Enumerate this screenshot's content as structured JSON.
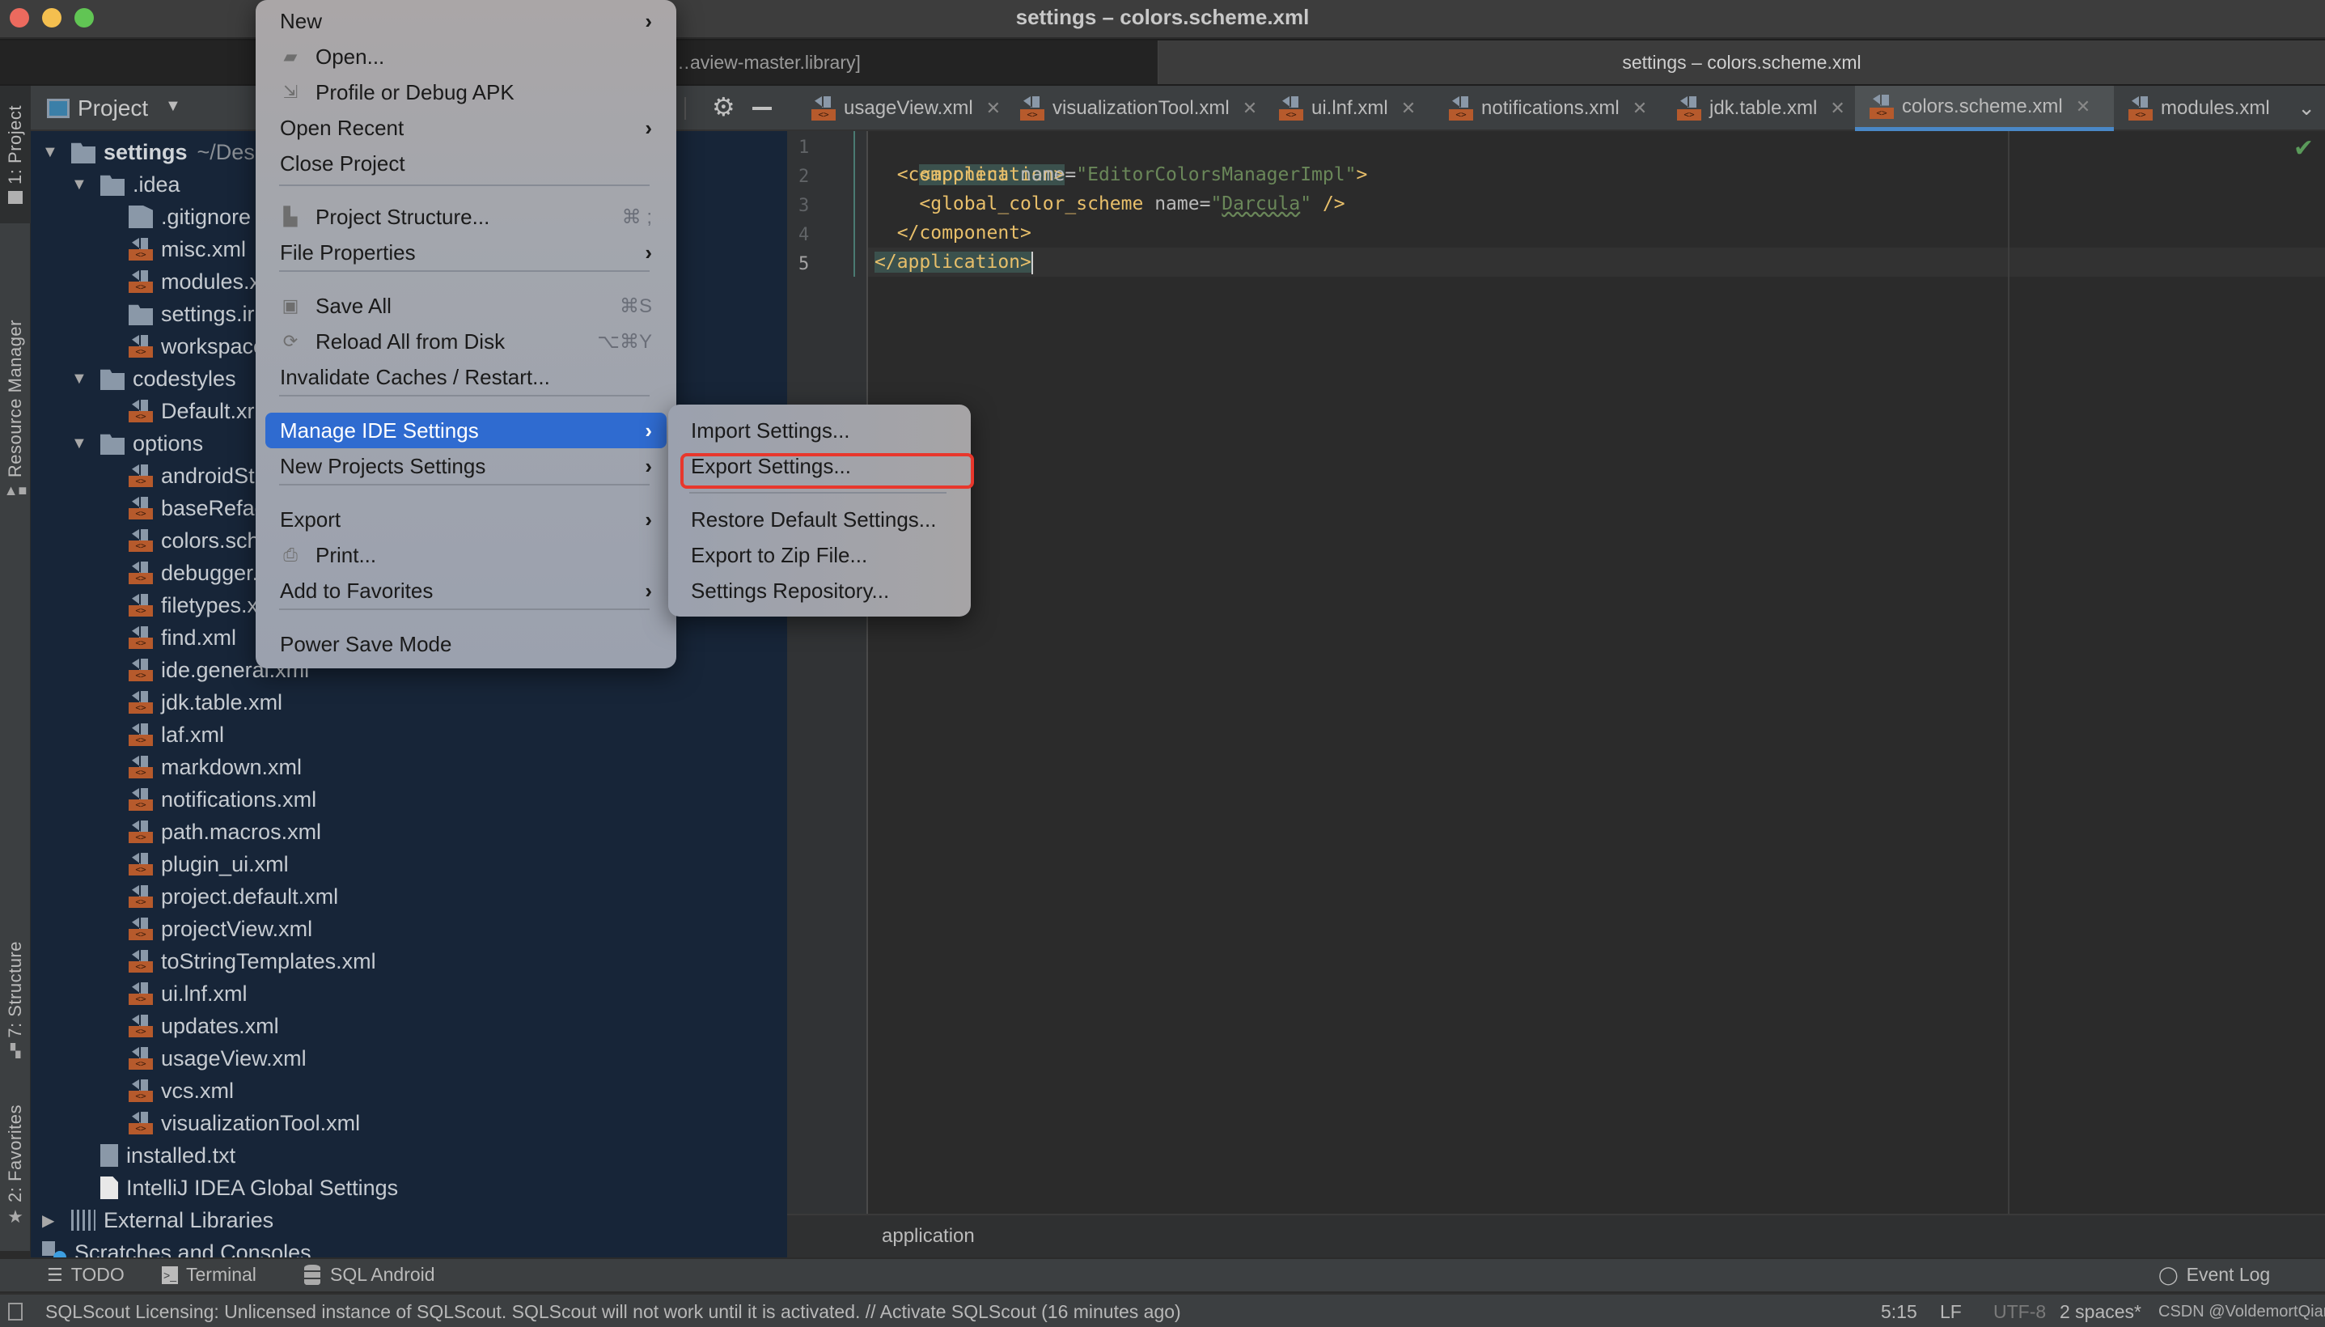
{
  "window": {
    "title": "settings – colors.scheme.xml",
    "tabs": [
      {
        "label": "…aview-master.library]",
        "active": false
      },
      {
        "label": "settings – colors.scheme.xml",
        "active": true
      }
    ]
  },
  "tool_stripe": {
    "left": [
      {
        "label": "1: Project",
        "active": true
      },
      {
        "label": "Resource Manager",
        "active": false
      },
      {
        "label": "7: Structure",
        "active": false
      },
      {
        "label": "2: Favorites",
        "active": false
      }
    ]
  },
  "project_panel": {
    "title": "Project",
    "tree": [
      {
        "label": "settings",
        "suffix": "~/Des",
        "type": "module",
        "depth": 0,
        "expanded": true
      },
      {
        "label": ".idea",
        "type": "folder",
        "depth": 1,
        "expanded": true
      },
      {
        "label": ".gitignore",
        "type": "ignore",
        "depth": 2
      },
      {
        "label": "misc.xml",
        "type": "xml",
        "depth": 2
      },
      {
        "label": "modules.x",
        "type": "xml",
        "depth": 2
      },
      {
        "label": "settings.ir",
        "type": "module",
        "depth": 2
      },
      {
        "label": "workspace",
        "type": "xml",
        "depth": 2
      },
      {
        "label": "codestyles",
        "type": "folder",
        "depth": 1,
        "expanded": true
      },
      {
        "label": "Default.xr",
        "type": "xml",
        "depth": 2
      },
      {
        "label": "options",
        "type": "folder",
        "depth": 1,
        "expanded": true
      },
      {
        "label": "androidSt",
        "type": "xml",
        "depth": 2
      },
      {
        "label": "baseRefac",
        "type": "xml",
        "depth": 2
      },
      {
        "label": "colors.sch",
        "type": "xml",
        "depth": 2
      },
      {
        "label": "debugger.",
        "type": "xml",
        "depth": 2
      },
      {
        "label": "filetypes.x",
        "type": "xml",
        "depth": 2
      },
      {
        "label": "find.xml",
        "type": "xml",
        "depth": 2
      },
      {
        "label": "ide.general.xml",
        "type": "xml",
        "depth": 2
      },
      {
        "label": "jdk.table.xml",
        "type": "xml",
        "depth": 2
      },
      {
        "label": "laf.xml",
        "type": "xml",
        "depth": 2
      },
      {
        "label": "markdown.xml",
        "type": "xml",
        "depth": 2
      },
      {
        "label": "notifications.xml",
        "type": "xml",
        "depth": 2
      },
      {
        "label": "path.macros.xml",
        "type": "xml",
        "depth": 2
      },
      {
        "label": "plugin_ui.xml",
        "type": "xml",
        "depth": 2
      },
      {
        "label": "project.default.xml",
        "type": "xml",
        "depth": 2
      },
      {
        "label": "projectView.xml",
        "type": "xml",
        "depth": 2
      },
      {
        "label": "toStringTemplates.xml",
        "type": "xml",
        "depth": 2
      },
      {
        "label": "ui.lnf.xml",
        "type": "xml",
        "depth": 2
      },
      {
        "label": "updates.xml",
        "type": "xml",
        "depth": 2
      },
      {
        "label": "usageView.xml",
        "type": "xml",
        "depth": 2
      },
      {
        "label": "vcs.xml",
        "type": "xml",
        "depth": 2
      },
      {
        "label": "visualizationTool.xml",
        "type": "xml",
        "depth": 2
      },
      {
        "label": "installed.txt",
        "type": "txt",
        "depth": 1
      },
      {
        "label": "IntelliJ IDEA Global Settings",
        "type": "plain",
        "depth": 1
      },
      {
        "label": "External Libraries",
        "type": "library",
        "depth": 0,
        "expanded": false
      },
      {
        "label": "Scratches and Consoles",
        "type": "scratch",
        "depth": 0
      }
    ]
  },
  "editor_tabs": [
    {
      "label": "usageView.xml",
      "active": false
    },
    {
      "label": "visualizationTool.xml",
      "active": false
    },
    {
      "label": "ui.lnf.xml",
      "active": false
    },
    {
      "label": "notifications.xml",
      "active": false
    },
    {
      "label": "jdk.table.xml",
      "active": false
    },
    {
      "label": "colors.scheme.xml",
      "active": true
    },
    {
      "label": "modules.xml",
      "active": false
    }
  ],
  "editor": {
    "lines": [
      "1",
      "2",
      "3",
      "4",
      "5"
    ],
    "code": {
      "l1": "<application>",
      "l2_tag": "  <component ",
      "l2_attr": "name=",
      "l2_val": "\"EditorColorsManagerImpl\"",
      "l2_end": ">",
      "l3_tag": "    <global_color_scheme ",
      "l3_attr": "name=",
      "l3_q1": "\"",
      "l3_val": "Darcula",
      "l3_q2": "\"",
      "l3_end": " />",
      "l4": "  </component>",
      "l5": "</application>"
    },
    "breadcrumb": "application"
  },
  "file_menu": {
    "items": [
      {
        "label": "New",
        "submenu": true
      },
      {
        "label": "Open...",
        "icon": "folder-open-icon"
      },
      {
        "label": "Profile or Debug APK",
        "icon": "profile-apk-icon"
      },
      {
        "label": "Open Recent",
        "submenu": true
      },
      {
        "label": "Close Project"
      },
      {
        "label": "Project Structure...",
        "icon": "project-structure-icon",
        "shortcut": "⌘ ;"
      },
      {
        "label": "File Properties",
        "submenu": true
      },
      {
        "label": "Save All",
        "icon": "save-icon",
        "shortcut": "⌘S"
      },
      {
        "label": "Reload All from Disk",
        "icon": "reload-icon",
        "shortcut": "⌥⌘Y"
      },
      {
        "label": "Invalidate Caches / Restart..."
      },
      {
        "label": "Manage IDE Settings",
        "submenu": true,
        "selected": true
      },
      {
        "label": "New Projects Settings",
        "submenu": true
      },
      {
        "label": "Export",
        "submenu": true
      },
      {
        "label": "Print...",
        "icon": "print-icon"
      },
      {
        "label": "Add to Favorites",
        "submenu": true
      },
      {
        "label": "Power Save Mode"
      }
    ]
  },
  "manage_settings_submenu": {
    "items": [
      {
        "label": "Import Settings..."
      },
      {
        "label": "Export Settings...",
        "highlighted": true
      },
      {
        "label": "Restore Default Settings..."
      },
      {
        "label": "Export to Zip File..."
      },
      {
        "label": "Settings Repository..."
      }
    ]
  },
  "bottom_tools": {
    "todo": "TODO",
    "terminal": "Terminal",
    "sql_android": "SQL Android",
    "event_log": "Event Log"
  },
  "status_bar": {
    "message": "SQLScout Licensing: Unlicensed instance of SQLScout. SQLScout will not work until it is activated. // Activate SQLScout (16 minutes ago)",
    "position": "5:15",
    "line_separator": "LF",
    "encoding": "UTF-8",
    "indent": "2 spaces*",
    "watermark": "CSDN @VoldemortQian"
  },
  "colors": {
    "selected_menu": "#2f6bd0",
    "highlight_box": "#e8372c",
    "active_tab_underline": "#4a88c7",
    "project_bg": "#172538",
    "xml_icon": "#b65a2c"
  }
}
